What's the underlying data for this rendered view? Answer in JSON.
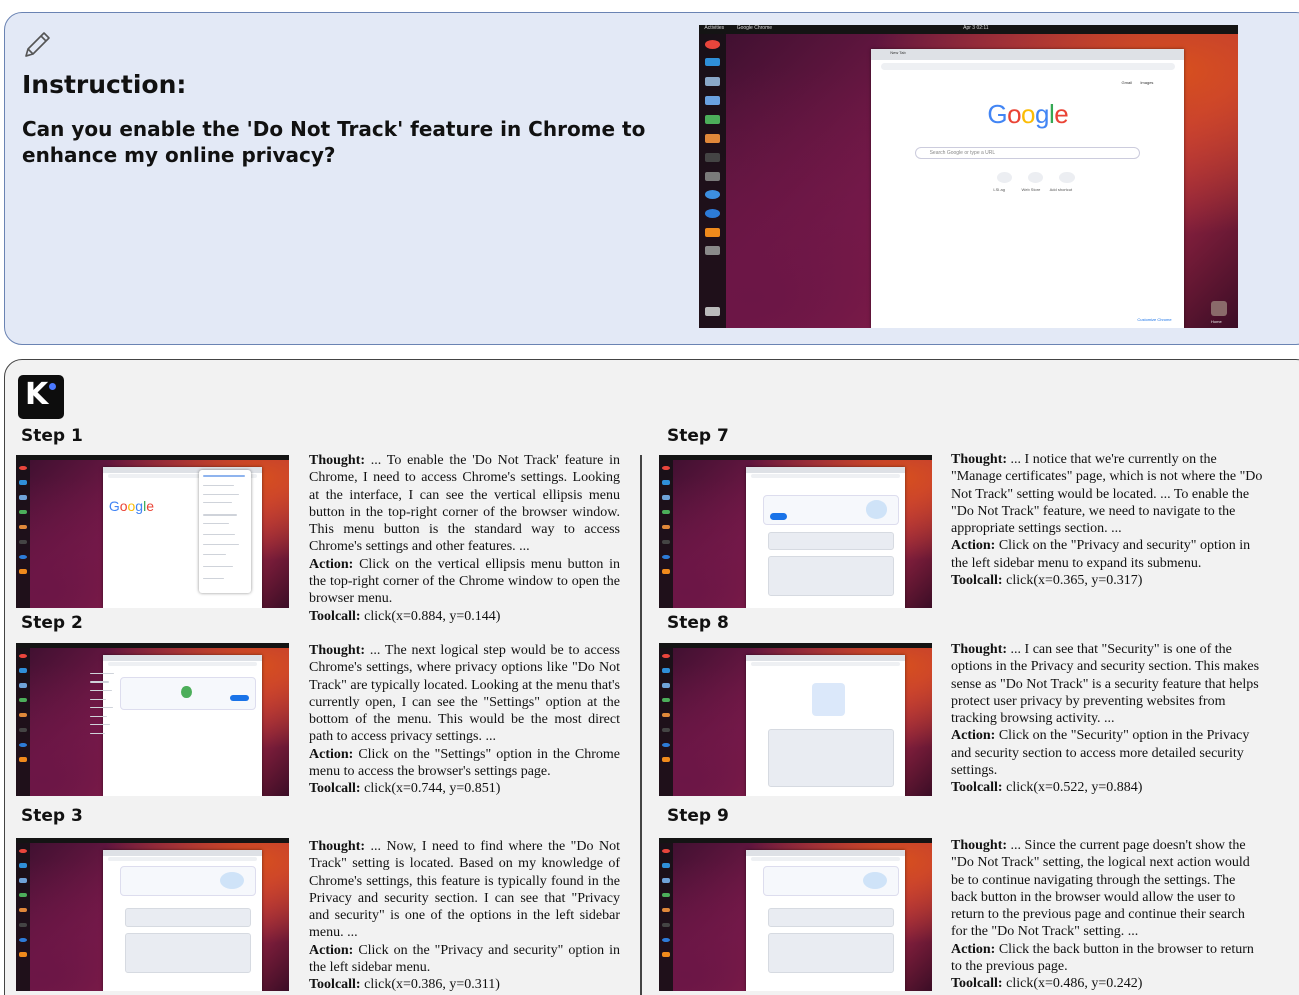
{
  "instruction": {
    "label": "Instruction:",
    "text": "Can you enable the 'Do Not Track' feature in Chrome to enhance my online privacy?",
    "icon": "pencil-icon"
  },
  "desktop": {
    "topbar_left": "Activities",
    "app_name": "Google Chrome",
    "clock": "Apr 3  02:11",
    "tab_title": "New Tab",
    "google_logo": [
      "G",
      "o",
      "o",
      "g",
      "l",
      "e"
    ],
    "search_placeholder": "Search Google or type a URL",
    "shortcuts": [
      "LSI.ag",
      "Web Store",
      "Add shortcut"
    ],
    "links": [
      "Gmail",
      "Images"
    ],
    "customize": "Customize Chrome",
    "trash_label": "Home"
  },
  "logo_text": "K",
  "field_labels": {
    "thought": "Thought:",
    "action": "Action:",
    "toolcall": "Toolcall:"
  },
  "steps": [
    {
      "title": "Step 1",
      "thought": "... To enable the 'Do Not Track' feature in Chrome, I need to access Chrome's settings. Looking at the interface, I can see the vertical ellipsis menu button in the top-right corner of the browser window. This menu button is the standard way to access Chrome's settings and other features. ...",
      "action": "Click on the vertical ellipsis menu button in the top-right corner of the Chrome window to open the browser menu.",
      "toolcall": "click(x=0.884, y=0.144)"
    },
    {
      "title": "Step 2",
      "thought": "... The next logical step would be to access Chrome's settings, where privacy options like \"Do Not Track\" are typically located. Looking at the menu that's currently open, I can see the \"Settings\" option at the bottom of the menu. This would be the most direct path to access privacy settings. ...",
      "action": "Click on the \"Settings\" option in the Chrome menu to access the browser's settings page.",
      "toolcall": "click(x=0.744, y=0.851)"
    },
    {
      "title": "Step 3",
      "thought": "... Now, I need to find where the \"Do Not Track\" setting is located. Based on my knowledge of Chrome's settings, this feature is typically found in the Privacy and security section. I can see that \"Privacy and security\" is one of the options in the left sidebar menu. ...",
      "action": "Click on the \"Privacy and security\" option in the left sidebar menu.",
      "toolcall": "click(x=0.386, y=0.311)"
    },
    {
      "title": "Step 7",
      "thought": "... I notice that we're currently on the \"Manage certificates\" page, which is not where the \"Do Not Track\" setting would be located. ... To enable the \"Do Not Track\" feature, we need to navigate to the appropriate settings section. ...",
      "action": "Click on the \"Privacy and security\" option in the left sidebar menu to expand its submenu.",
      "toolcall": "click(x=0.365, y=0.317)"
    },
    {
      "title": "Step 8",
      "thought": "... I can see that \"Security\" is one of the options in the Privacy and security section. This makes sense as \"Do Not Track\" is a security feature that helps protect user privacy by preventing websites from tracking browsing activity. ...",
      "action": "Click on the \"Security\" option in the Privacy and security section to access more detailed security settings.",
      "toolcall": "click(x=0.522, y=0.884)"
    },
    {
      "title": "Step 9",
      "thought": "... Since the current page doesn't show the \"Do Not Track\" setting, the logical next action would be to continue navigating through the settings. The back button in the browser would allow the user to return to the previous page and continue their search for the \"Do Not Track\" setting. ...",
      "action": "Click the back button in the browser to return to the previous page.",
      "toolcall": "click(x=0.486, y=0.242)"
    }
  ]
}
